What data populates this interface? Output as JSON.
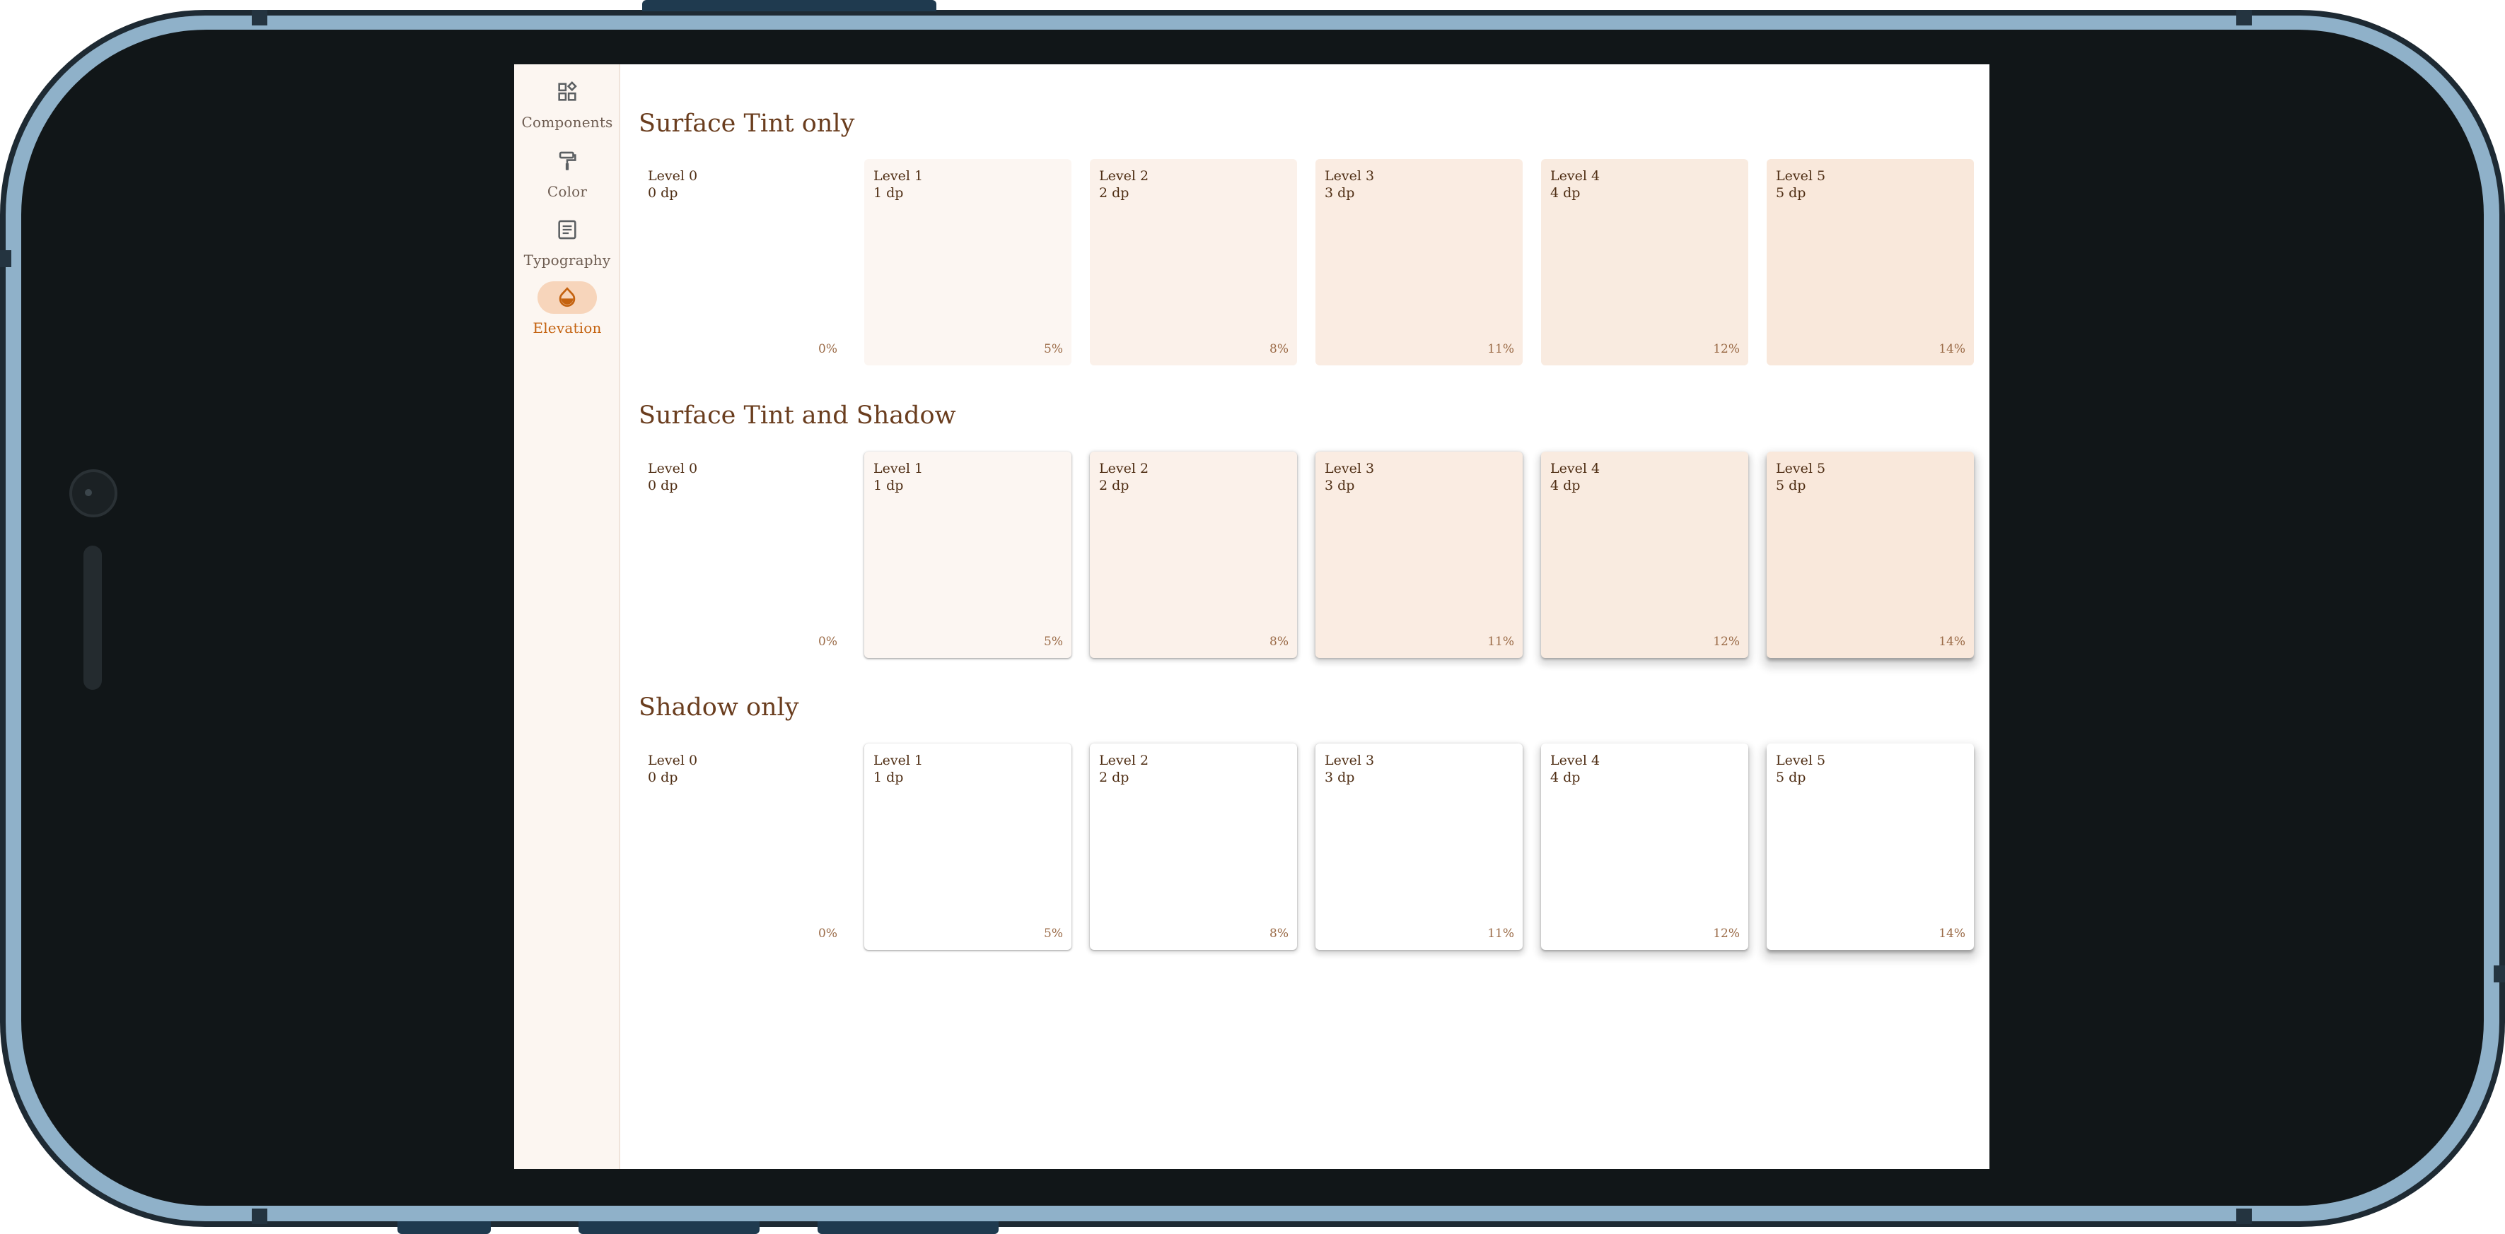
{
  "navigation": {
    "items": [
      {
        "label": "Components",
        "icon": "widgets-icon",
        "active": false
      },
      {
        "label": "Color",
        "icon": "format-paint-icon",
        "active": false
      },
      {
        "label": "Typography",
        "icon": "article-icon",
        "active": false
      },
      {
        "label": "Elevation",
        "icon": "invert-colors-icon",
        "active": true
      }
    ]
  },
  "colors": {
    "accent": "#c4620f",
    "accent_container": "#f7d5bb",
    "rail_background": "#fcf6f1",
    "title_text": "#6a3d1e",
    "tile_text": "#4f2e14",
    "percent_text": "#9a6a46"
  },
  "sections": [
    {
      "title": "Surface Tint only",
      "tint": true,
      "shadow": false,
      "tiles": [
        {
          "level": "Level 0",
          "dp": "0 dp",
          "percent": "0%",
          "color": "#ffffff"
        },
        {
          "level": "Level 1",
          "dp": "1 dp",
          "percent": "5%",
          "color": "#fcf6f2"
        },
        {
          "level": "Level 2",
          "dp": "2 dp",
          "percent": "8%",
          "color": "#fbf1ea"
        },
        {
          "level": "Level 3",
          "dp": "3 dp",
          "percent": "11%",
          "color": "#faece2"
        },
        {
          "level": "Level 4",
          "dp": "4 dp",
          "percent": "12%",
          "color": "#f9ebe0"
        },
        {
          "level": "Level 5",
          "dp": "5 dp",
          "percent": "14%",
          "color": "#f9e8db"
        }
      ]
    },
    {
      "title": "Surface Tint and Shadow",
      "tint": true,
      "shadow": true,
      "tiles": [
        {
          "level": "Level 0",
          "dp": "0 dp",
          "percent": "0%",
          "color": "#ffffff"
        },
        {
          "level": "Level 1",
          "dp": "1 dp",
          "percent": "5%",
          "color": "#fcf6f2"
        },
        {
          "level": "Level 2",
          "dp": "2 dp",
          "percent": "8%",
          "color": "#fbf1ea"
        },
        {
          "level": "Level 3",
          "dp": "3 dp",
          "percent": "11%",
          "color": "#faece2"
        },
        {
          "level": "Level 4",
          "dp": "4 dp",
          "percent": "12%",
          "color": "#f9ebe0"
        },
        {
          "level": "Level 5",
          "dp": "5 dp",
          "percent": "14%",
          "color": "#f9e8db"
        }
      ]
    },
    {
      "title": "Shadow only",
      "tint": false,
      "shadow": true,
      "tiles": [
        {
          "level": "Level 0",
          "dp": "0 dp",
          "percent": "0%",
          "color": "#ffffff"
        },
        {
          "level": "Level 1",
          "dp": "1 dp",
          "percent": "5%",
          "color": "#ffffff"
        },
        {
          "level": "Level 2",
          "dp": "2 dp",
          "percent": "8%",
          "color": "#ffffff"
        },
        {
          "level": "Level 3",
          "dp": "3 dp",
          "percent": "11%",
          "color": "#ffffff"
        },
        {
          "level": "Level 4",
          "dp": "4 dp",
          "percent": "12%",
          "color": "#ffffff"
        },
        {
          "level": "Level 5",
          "dp": "5 dp",
          "percent": "14%",
          "color": "#ffffff"
        }
      ]
    }
  ]
}
